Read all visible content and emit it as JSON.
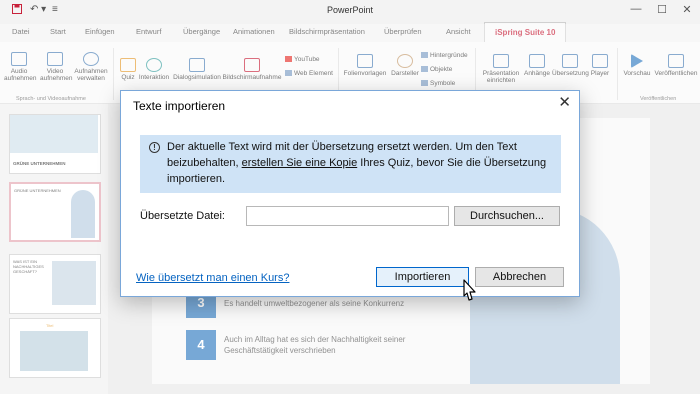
{
  "app": {
    "title": "PowerPoint"
  },
  "tabs": [
    "Datei",
    "Start",
    "Einfügen",
    "Entwurf",
    "Übergänge",
    "Animationen",
    "Bildschirmpräsentation",
    "Überprüfen",
    "Ansicht",
    "iSpring Suite 10"
  ],
  "ribbon": {
    "audio": "Audio\naufnehmen",
    "video": "Video\naufnehmen",
    "manage": "Aufnahmen\nverwalten",
    "group_audio_video": "Sprach- und Videoaufnahme",
    "quiz": "Quiz",
    "interaction": "Interaktion",
    "dialog_sim": "Dialogsimulation",
    "screen_rec": "Bildschirmaufnahme",
    "youtube": "YouTube",
    "web_object": "Web Element",
    "templates": "Folienvorlagen",
    "presenter": "Darsteller",
    "backgrounds": "Hintergründe",
    "objects": "Objekte",
    "symbols": "Symbole",
    "presentation": "Präsentation\neinrichten",
    "attachments": "Anhänge",
    "translation": "Übersetzung",
    "player": "Player",
    "preview": "Vorschau",
    "publish": "Veröffentlichen",
    "group_publish": "Veröffentlichen"
  },
  "thumbs": {
    "t1_title": "GRÜNE UNTERNEHMEN",
    "t2_title": "GRÜNE UNTERNEHMEN",
    "t3_title": "WAS IST EIN NACHHALTIGES GESCHÄFT?",
    "t4_title": "Titel"
  },
  "slide": {
    "item3_num": "3",
    "item3_text": "Es handelt umweltbezogener als seine Konkurrenz",
    "item4_num": "4",
    "item4_text": "Auch im Alltag hat es sich der Nachhaltigkeit seiner Geschäftstätigkeit verschrieben"
  },
  "dialog": {
    "title": "Texte importieren",
    "info_before": "Der aktuelle Text wird mit der Übersetzung ersetzt werden. Um den Text beizubehalten, ",
    "info_link": "erstellen Sie eine Kopie",
    "info_after": " Ihres Quiz, bevor Sie die Übersetzung importieren.",
    "file_label": "Übersetzte Datei:",
    "file_value": "",
    "browse": "Durchsuchen...",
    "help": "Wie übersetzt man einen Kurs?",
    "import": "Importieren",
    "cancel": "Abbrechen"
  },
  "colors": {
    "accent": "#c8213a",
    "info_bg": "#cfe3f6",
    "link": "#0563c1",
    "slide_number": "#2e7ac1"
  }
}
